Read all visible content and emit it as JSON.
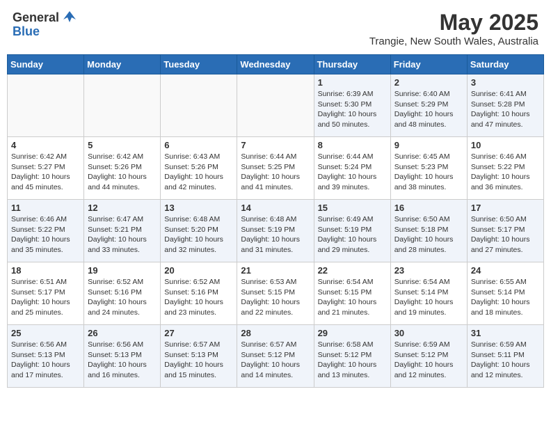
{
  "header": {
    "logo_general": "General",
    "logo_blue": "Blue",
    "title": "May 2025",
    "location": "Trangie, New South Wales, Australia"
  },
  "weekdays": [
    "Sunday",
    "Monday",
    "Tuesday",
    "Wednesday",
    "Thursday",
    "Friday",
    "Saturday"
  ],
  "weeks": [
    [
      {
        "day": "",
        "info": ""
      },
      {
        "day": "",
        "info": ""
      },
      {
        "day": "",
        "info": ""
      },
      {
        "day": "",
        "info": ""
      },
      {
        "day": "1",
        "info": "Sunrise: 6:39 AM\nSunset: 5:30 PM\nDaylight: 10 hours\nand 50 minutes."
      },
      {
        "day": "2",
        "info": "Sunrise: 6:40 AM\nSunset: 5:29 PM\nDaylight: 10 hours\nand 48 minutes."
      },
      {
        "day": "3",
        "info": "Sunrise: 6:41 AM\nSunset: 5:28 PM\nDaylight: 10 hours\nand 47 minutes."
      }
    ],
    [
      {
        "day": "4",
        "info": "Sunrise: 6:42 AM\nSunset: 5:27 PM\nDaylight: 10 hours\nand 45 minutes."
      },
      {
        "day": "5",
        "info": "Sunrise: 6:42 AM\nSunset: 5:26 PM\nDaylight: 10 hours\nand 44 minutes."
      },
      {
        "day": "6",
        "info": "Sunrise: 6:43 AM\nSunset: 5:26 PM\nDaylight: 10 hours\nand 42 minutes."
      },
      {
        "day": "7",
        "info": "Sunrise: 6:44 AM\nSunset: 5:25 PM\nDaylight: 10 hours\nand 41 minutes."
      },
      {
        "day": "8",
        "info": "Sunrise: 6:44 AM\nSunset: 5:24 PM\nDaylight: 10 hours\nand 39 minutes."
      },
      {
        "day": "9",
        "info": "Sunrise: 6:45 AM\nSunset: 5:23 PM\nDaylight: 10 hours\nand 38 minutes."
      },
      {
        "day": "10",
        "info": "Sunrise: 6:46 AM\nSunset: 5:22 PM\nDaylight: 10 hours\nand 36 minutes."
      }
    ],
    [
      {
        "day": "11",
        "info": "Sunrise: 6:46 AM\nSunset: 5:22 PM\nDaylight: 10 hours\nand 35 minutes."
      },
      {
        "day": "12",
        "info": "Sunrise: 6:47 AM\nSunset: 5:21 PM\nDaylight: 10 hours\nand 33 minutes."
      },
      {
        "day": "13",
        "info": "Sunrise: 6:48 AM\nSunset: 5:20 PM\nDaylight: 10 hours\nand 32 minutes."
      },
      {
        "day": "14",
        "info": "Sunrise: 6:48 AM\nSunset: 5:19 PM\nDaylight: 10 hours\nand 31 minutes."
      },
      {
        "day": "15",
        "info": "Sunrise: 6:49 AM\nSunset: 5:19 PM\nDaylight: 10 hours\nand 29 minutes."
      },
      {
        "day": "16",
        "info": "Sunrise: 6:50 AM\nSunset: 5:18 PM\nDaylight: 10 hours\nand 28 minutes."
      },
      {
        "day": "17",
        "info": "Sunrise: 6:50 AM\nSunset: 5:17 PM\nDaylight: 10 hours\nand 27 minutes."
      }
    ],
    [
      {
        "day": "18",
        "info": "Sunrise: 6:51 AM\nSunset: 5:17 PM\nDaylight: 10 hours\nand 25 minutes."
      },
      {
        "day": "19",
        "info": "Sunrise: 6:52 AM\nSunset: 5:16 PM\nDaylight: 10 hours\nand 24 minutes."
      },
      {
        "day": "20",
        "info": "Sunrise: 6:52 AM\nSunset: 5:16 PM\nDaylight: 10 hours\nand 23 minutes."
      },
      {
        "day": "21",
        "info": "Sunrise: 6:53 AM\nSunset: 5:15 PM\nDaylight: 10 hours\nand 22 minutes."
      },
      {
        "day": "22",
        "info": "Sunrise: 6:54 AM\nSunset: 5:15 PM\nDaylight: 10 hours\nand 21 minutes."
      },
      {
        "day": "23",
        "info": "Sunrise: 6:54 AM\nSunset: 5:14 PM\nDaylight: 10 hours\nand 19 minutes."
      },
      {
        "day": "24",
        "info": "Sunrise: 6:55 AM\nSunset: 5:14 PM\nDaylight: 10 hours\nand 18 minutes."
      }
    ],
    [
      {
        "day": "25",
        "info": "Sunrise: 6:56 AM\nSunset: 5:13 PM\nDaylight: 10 hours\nand 17 minutes."
      },
      {
        "day": "26",
        "info": "Sunrise: 6:56 AM\nSunset: 5:13 PM\nDaylight: 10 hours\nand 16 minutes."
      },
      {
        "day": "27",
        "info": "Sunrise: 6:57 AM\nSunset: 5:13 PM\nDaylight: 10 hours\nand 15 minutes."
      },
      {
        "day": "28",
        "info": "Sunrise: 6:57 AM\nSunset: 5:12 PM\nDaylight: 10 hours\nand 14 minutes."
      },
      {
        "day": "29",
        "info": "Sunrise: 6:58 AM\nSunset: 5:12 PM\nDaylight: 10 hours\nand 13 minutes."
      },
      {
        "day": "30",
        "info": "Sunrise: 6:59 AM\nSunset: 5:12 PM\nDaylight: 10 hours\nand 12 minutes."
      },
      {
        "day": "31",
        "info": "Sunrise: 6:59 AM\nSunset: 5:11 PM\nDaylight: 10 hours\nand 12 minutes."
      }
    ]
  ]
}
